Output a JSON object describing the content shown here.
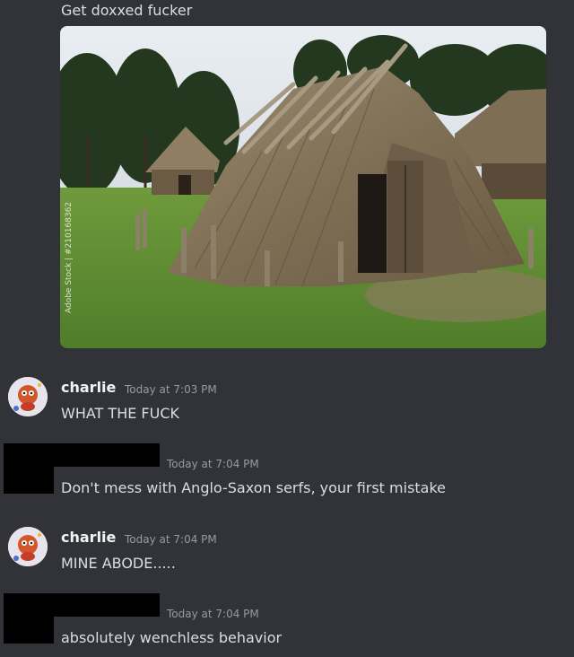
{
  "first_message": {
    "text": "Get doxxed fucker",
    "attachment": {
      "description": "thatched hut image",
      "watermark": "Adobe Stock | #210168362"
    }
  },
  "messages": [
    {
      "author": "charlie",
      "timestamp": "Today at 7:03 PM",
      "text": "WHAT THE FUCK",
      "avatar": "charlie-avatar",
      "redacted": false
    },
    {
      "author": "",
      "timestamp": "Today at 7:04 PM",
      "text": "Don't mess with Anglo-Saxon serfs, your first mistake",
      "avatar": "redacted",
      "redacted": true
    },
    {
      "author": "charlie",
      "timestamp": "Today at 7:04 PM",
      "text": "MINE ABODE.....",
      "avatar": "charlie-avatar",
      "redacted": false
    },
    {
      "author": "",
      "timestamp": "Today at 7:04 PM",
      "text": "absolutely wenchless behavior",
      "avatar": "redacted",
      "redacted": true
    }
  ],
  "colors": {
    "background": "#313338",
    "text": "#dbdee1",
    "username": "#f2f3f5",
    "timestamp": "#949ba4"
  }
}
